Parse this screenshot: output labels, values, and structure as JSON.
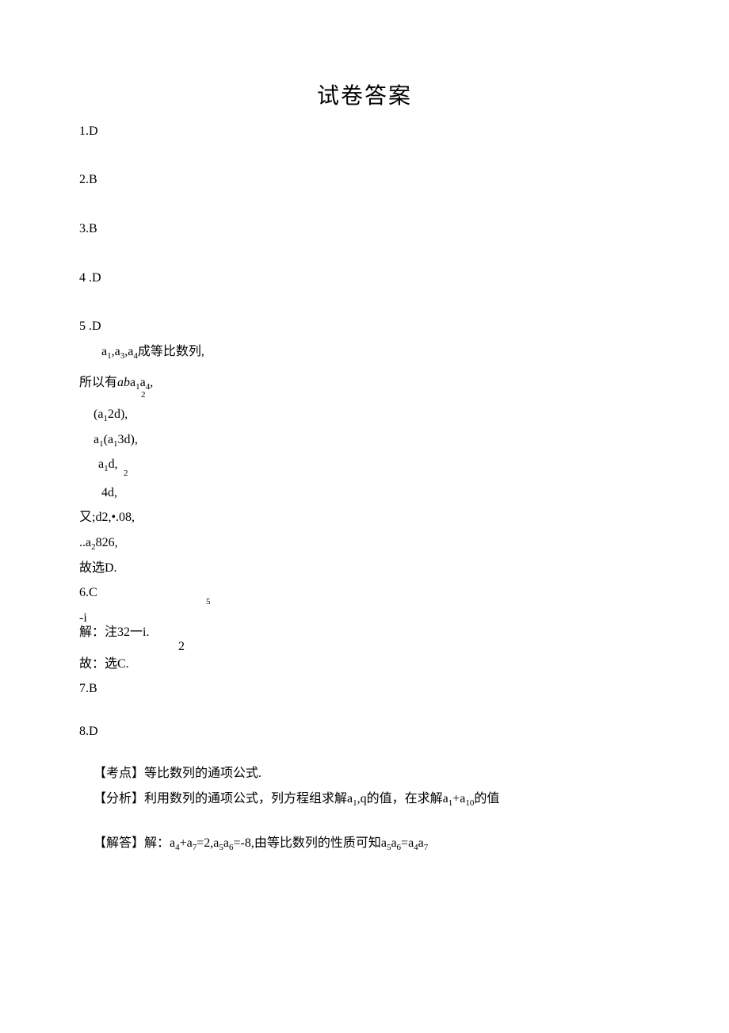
{
  "title": "试卷答案",
  "q1": "1.D",
  "q2": "2.B",
  "q3": "3.B",
  "q4": "4 .D",
  "q5": {
    "head": "5 .D",
    "l1_pre": "a",
    "l1_s1": "1",
    "l1_mid1": ",a",
    "l1_s2": "3",
    "l1_mid2": ",a",
    "l1_s3": "4",
    "l1_tail": "成等比数列,",
    "l2_pre": "所以有",
    "l2_ab": "ab",
    "l2_a": "a",
    "l2_s1": "1",
    "l2_a2": "a",
    "l2_s2": "4",
    "l2_comma": ",",
    "l3_sup": "2",
    "l3_open": "(a",
    "l3_s1": "1",
    "l3_rest": "2d),",
    "l4_a": "a",
    "l4_s1": "1",
    "l4_open": "(a",
    "l4_s2": "1",
    "l4_rest": "3d),",
    "l5_a": "a",
    "l5_s1": "1",
    "l5_rest": "d,",
    "l6_sup": "2",
    "l6_main": "4d,",
    "l7": "又;d2,•.08,",
    "l8_dots": "..a",
    "l8_s1": "2",
    "l8_rest": "826,",
    "l9": "故选D."
  },
  "q6": {
    "head": "6.C",
    "neg_i": "-i",
    "sup5": "5",
    "main": "解：注32一i.",
    "sub2": "2",
    "tail": "故：选C."
  },
  "q7": "7.B",
  "q8": {
    "head": "8.D",
    "kaodian": "【考点】等比数列的通项公式.",
    "fenxi_pre": "【分析】利用数列的通项公式，列方程组求解a",
    "fenxi_s1": "1",
    "fenxi_mid1": ",q的值，在求解a",
    "fenxi_s2": "1",
    "fenxi_mid2": "+a",
    "fenxi_s3": "10",
    "fenxi_tail": "的值",
    "jieda_pre": "【解答】解：a",
    "jieda_s1": "4",
    "jieda_m1": "+a",
    "jieda_s2": "7",
    "jieda_m2": "=2,a",
    "jieda_s3": "5",
    "jieda_m3": "a",
    "jieda_s4": "6",
    "jieda_m4": "=-8,由等比数列的性质可知a",
    "jieda_s5": "5",
    "jieda_m5": "a",
    "jieda_s6": "6",
    "jieda_m6": "=a",
    "jieda_s7": "4",
    "jieda_m7": "a",
    "jieda_s8": "7"
  }
}
